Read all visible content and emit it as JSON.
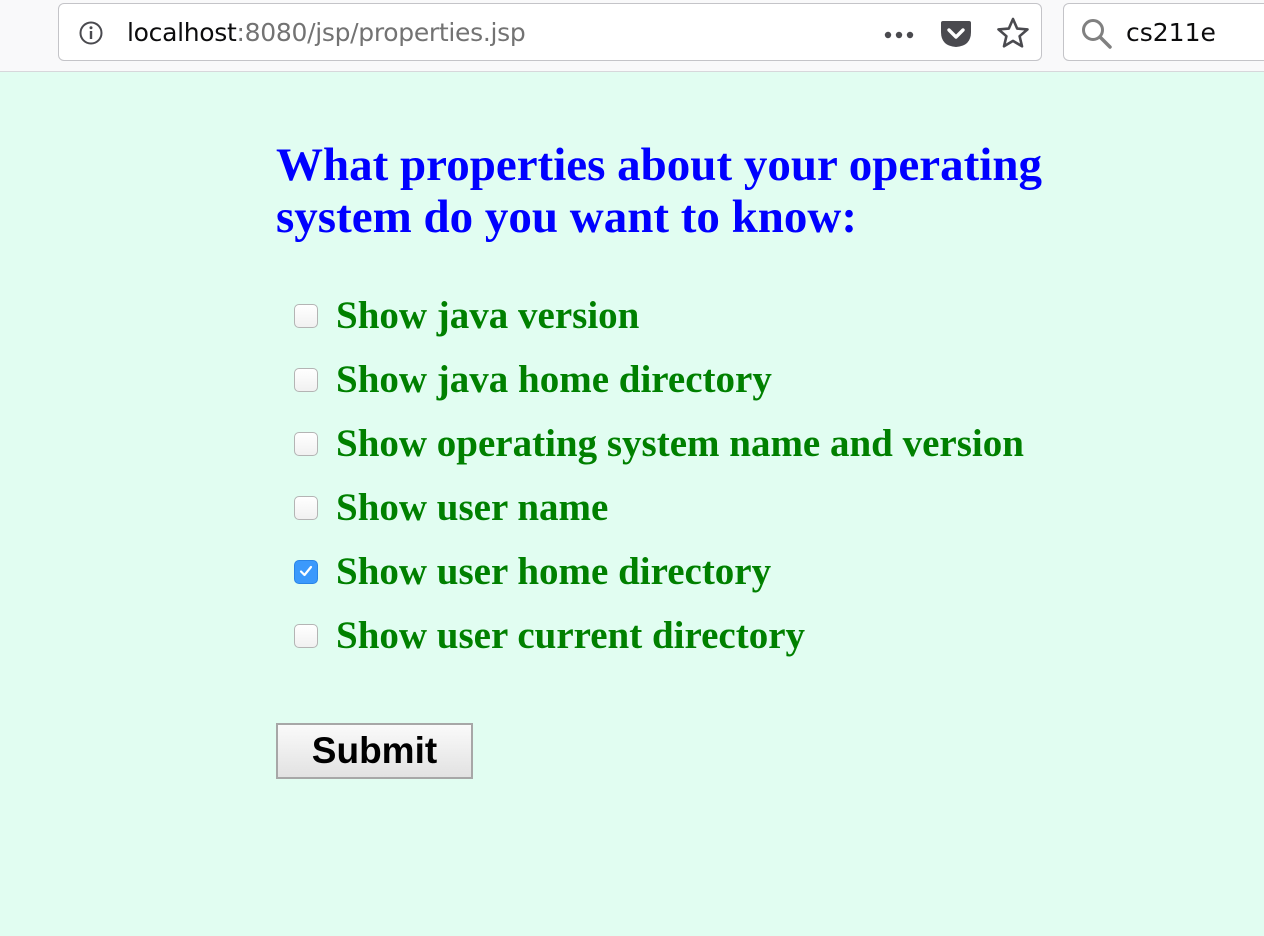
{
  "browser": {
    "url_host": "localhost",
    "url_rest": ":8080/jsp/properties.jsp",
    "search_value": "cs211e"
  },
  "form": {
    "heading": "What properties about your operating system do you want to know:",
    "options": [
      {
        "label": "Show java version",
        "checked": false
      },
      {
        "label": "Show java home directory",
        "checked": false
      },
      {
        "label": "Show operating system name and version",
        "checked": false
      },
      {
        "label": "Show user name",
        "checked": false
      },
      {
        "label": "Show user home directory",
        "checked": true
      },
      {
        "label": "Show user current directory",
        "checked": false
      }
    ],
    "submit_label": "Submit"
  },
  "colors": {
    "page_background": "#e1fdf1",
    "heading": "#0000ff",
    "option_label": "#008000",
    "checkbox_checked": "#3b99fc"
  },
  "icons": {
    "site_info": "info-icon",
    "page_actions": "more-icon",
    "pocket": "pocket-icon",
    "bookmark": "star-icon",
    "search": "search-icon",
    "checkmark": "checkmark-icon"
  }
}
